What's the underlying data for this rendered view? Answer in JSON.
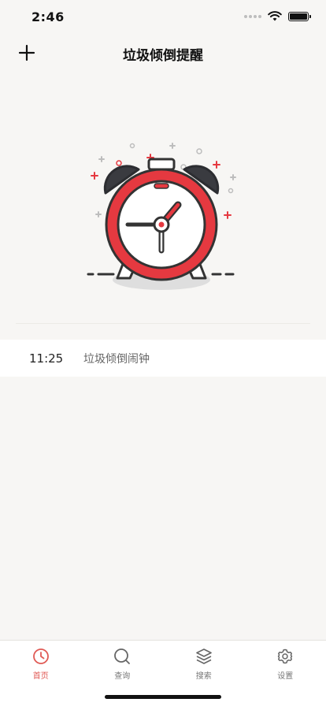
{
  "status_bar": {
    "time": "2:46"
  },
  "nav": {
    "title": "垃圾倾倒提醒"
  },
  "alarms": [
    {
      "time": "11:25",
      "label": "垃圾倾倒闹钟"
    }
  ],
  "tabs": [
    {
      "label": "首页",
      "icon": "clock-icon",
      "active": true
    },
    {
      "label": "查询",
      "icon": "search-icon",
      "active": false
    },
    {
      "label": "搜索",
      "icon": "layers-icon",
      "active": false
    },
    {
      "label": "设置",
      "icon": "gear-icon",
      "active": false
    }
  ],
  "colors": {
    "accent": "#e05a55",
    "alarm_red": "#e53940",
    "background": "#f7f6f4"
  }
}
